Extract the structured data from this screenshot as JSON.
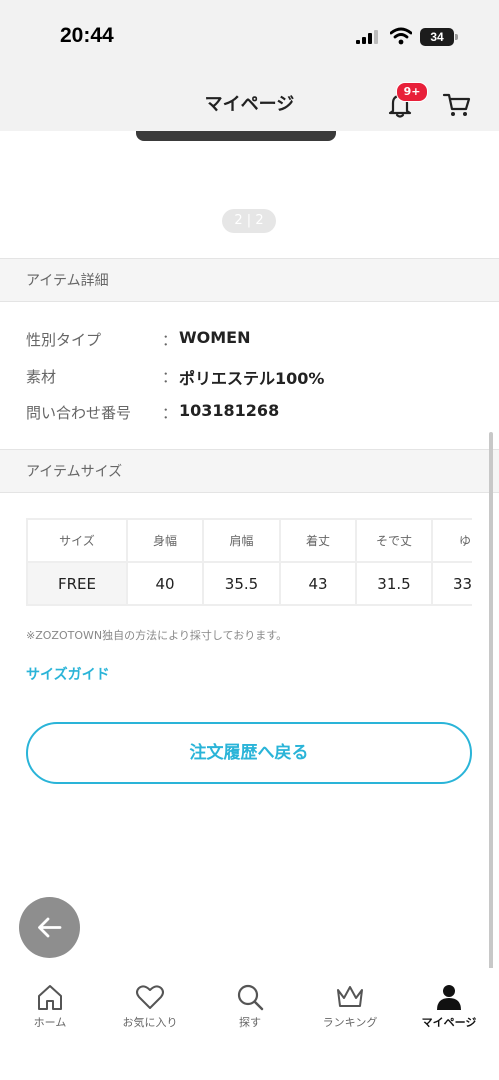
{
  "status_bar": {
    "time": "20:44",
    "battery": "34"
  },
  "header": {
    "title": "マイページ",
    "notification_badge": "9+"
  },
  "gallery": {
    "pager": "2 | 2"
  },
  "item_details": {
    "heading": "アイテム詳細",
    "rows": [
      {
        "label": "性別タイプ",
        "colon": "：",
        "value": "WOMEN"
      },
      {
        "label": "素材",
        "colon": "：",
        "value": "ポリエステル100%"
      },
      {
        "label": "問い合わせ番号",
        "colon": "：",
        "value": "103181268"
      }
    ]
  },
  "item_size": {
    "heading": "アイテムサイズ",
    "columns": [
      "サイズ",
      "身幅",
      "肩幅",
      "着丈",
      "そで丈",
      "ゆ"
    ],
    "row": [
      "FREE",
      "40",
      "35.5",
      "43",
      "31.5",
      "33"
    ],
    "note": "※ZOZOTOWN独自の方法により採寸しております。",
    "guide_link": "サイズガイド"
  },
  "back_button": "注文履歴へ戻る",
  "tabbar": {
    "items": [
      {
        "label": "ホーム",
        "icon": "home-icon"
      },
      {
        "label": "お気に入り",
        "icon": "heart-icon"
      },
      {
        "label": "探す",
        "icon": "search-icon"
      },
      {
        "label": "ランキング",
        "icon": "crown-icon"
      },
      {
        "label": "マイページ",
        "icon": "person-icon",
        "active": true
      }
    ]
  },
  "colors": {
    "accent": "#2ab4d8",
    "badge": "#e8203a"
  }
}
